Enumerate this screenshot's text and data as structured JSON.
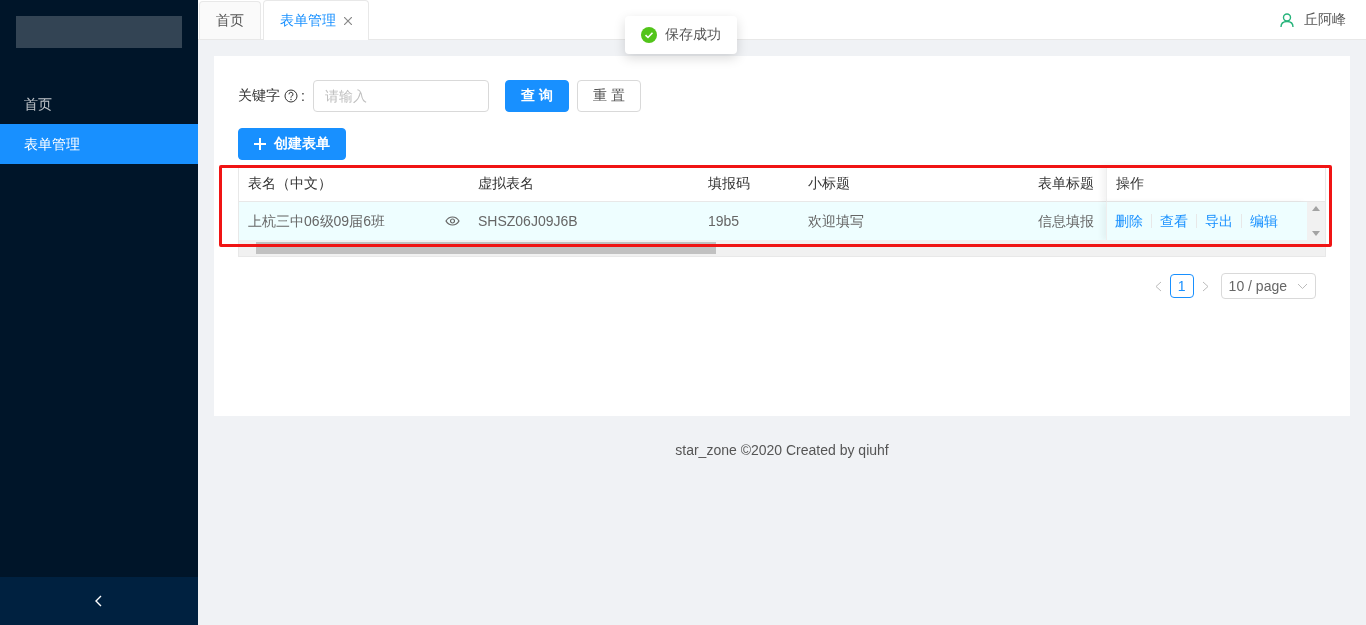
{
  "sidebar": {
    "items": [
      {
        "label": "首页",
        "selected": false
      },
      {
        "label": "表单管理",
        "selected": true
      }
    ]
  },
  "tabs": [
    {
      "label": "首页",
      "selected": false,
      "closable": false
    },
    {
      "label": "表单管理",
      "selected": true,
      "closable": true
    }
  ],
  "user": {
    "name": "丘阿峰"
  },
  "toast": {
    "kind": "success",
    "text": "保存成功"
  },
  "search": {
    "label": "关键字",
    "colon": ":",
    "placeholder": "请输入",
    "buttons": [
      "查 询",
      "重 置"
    ]
  },
  "create_button": "创建表单",
  "table": {
    "columns": [
      "表名（中文）",
      "虚拟表名",
      "填报码",
      "小标题",
      "表单标题",
      "操作"
    ],
    "rows": [
      {
        "cells": [
          "上杭三中06级09届6班",
          "SHSZ06J09J6B",
          "19b5",
          "欢迎填写",
          "信息填报"
        ],
        "actions": [
          "删除",
          "查看",
          "导出",
          "编辑"
        ]
      }
    ]
  },
  "pagination": {
    "pages": [
      {
        "label": "1",
        "selected": true
      }
    ],
    "page_size": "10 / page"
  },
  "footer": "star_zone ©2020 Created by qiuhf"
}
